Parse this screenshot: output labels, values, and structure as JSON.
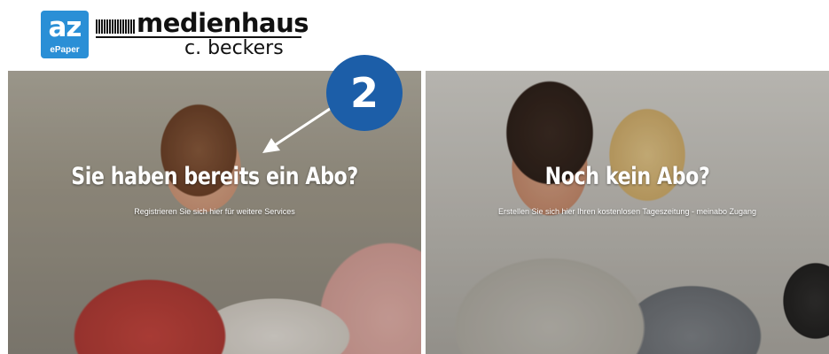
{
  "header": {
    "az_logo": {
      "main": "az",
      "sub": "ePaper",
      "color": "#2a8fd6"
    },
    "publisher_logo": {
      "name": "medienhaus",
      "sub": "c. beckers"
    }
  },
  "step_badge": {
    "number": "2",
    "color": "#1c5ea8"
  },
  "panels": [
    {
      "title": "Sie haben bereits ein Abo?",
      "subtitle": "Registrieren Sie sich hier für weitere Services"
    },
    {
      "title": "Noch kein Abo?",
      "subtitle": "Erstellen Sie sich hier Ihren kostenlosen Tageszeitung - meinabo Zugang"
    }
  ]
}
